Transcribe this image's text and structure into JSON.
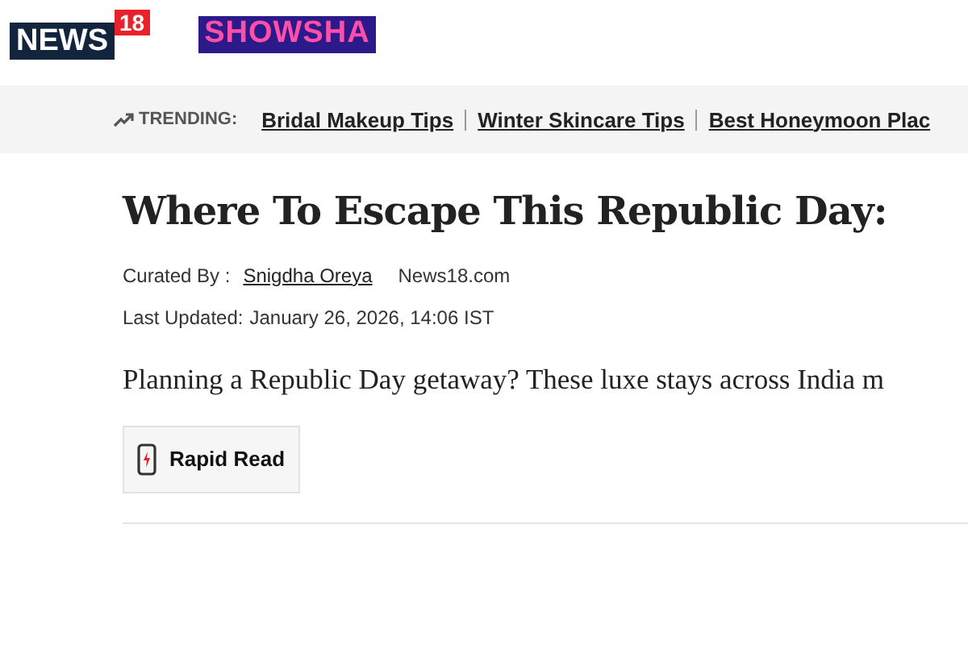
{
  "header": {
    "logo": {
      "main": "NEWS",
      "badge": "18"
    },
    "section_logo": "SHOWSHA"
  },
  "trending": {
    "label": "TRENDING:",
    "items": [
      "Bridal Makeup Tips",
      "Winter Skincare Tips",
      "Best Honeymoon Plac"
    ]
  },
  "article": {
    "headline": "Where To Escape This Republic Day:",
    "byline": {
      "label": "Curated By :",
      "author": "Snigdha Oreya",
      "source": "News18.com"
    },
    "updated": {
      "label": "Last Updated:",
      "value": "January 26, 2026, 14:06 IST"
    },
    "summary": "Planning a Republic Day getaway? These luxe stays across India m",
    "rapid_read": "Rapid Read"
  }
}
